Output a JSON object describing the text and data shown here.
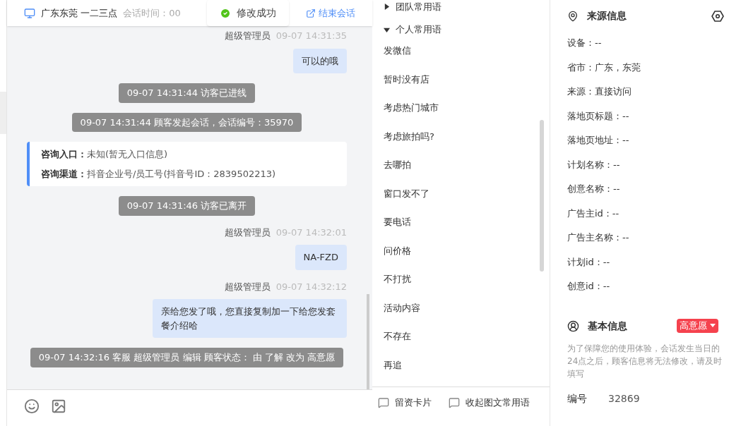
{
  "header": {
    "title": "广东东莞 一二三点",
    "session_time": "会话时间：00",
    "end_link": "结束会话"
  },
  "toast": {
    "text": "修改成功"
  },
  "messages": [
    {
      "kind": "agent",
      "sender": "超级管理员",
      "time": "09-07 14:31:35",
      "text": "可以的哦"
    },
    {
      "kind": "system",
      "text": "09-07 14:31:44 访客已进线"
    },
    {
      "kind": "system",
      "text": "09-07 14:31:44 顾客发起会话，会话编号：35970"
    },
    {
      "kind": "info",
      "rows": [
        {
          "label": "咨询入口：",
          "value": "未知(暂无入口信息)"
        },
        {
          "label": "咨询渠道：",
          "value": "抖音企业号/员工号(抖音号ID：2839502213)"
        }
      ]
    },
    {
      "kind": "system",
      "text": "09-07 14:31:46 访客已离开"
    },
    {
      "kind": "agent",
      "sender": "超级管理员",
      "time": "09-07 14:32:01",
      "text": "NA-FZD"
    },
    {
      "kind": "agent",
      "sender": "超级管理员",
      "time": "09-07 14:32:12",
      "text": "亲给您发了哦，您直接复制加一下给您发套餐介绍哈"
    },
    {
      "kind": "system",
      "text": "09-07 14:32:16 客服 超级管理员 编辑 顾客状态： 由 了解 改为 高意愿"
    }
  ],
  "phrases": {
    "groups": [
      {
        "title": "团队常用语",
        "expanded": false
      },
      {
        "title": "个人常用语",
        "expanded": true
      }
    ],
    "items": [
      "发微信",
      "暂时没有店",
      "考虑热门城市",
      "考虑旅拍吗?",
      "去哪拍",
      "窗口发不了",
      "要电话",
      "问价格",
      "不打扰",
      "活动内容",
      "不存在",
      "再追"
    ],
    "actions": [
      "留资卡片",
      "收起图文常用语"
    ]
  },
  "source_info": {
    "title": "来源信息",
    "fields": [
      "设备：--",
      "省市：广东，东莞",
      "来源：直接访问",
      "落地页标题：--",
      "落地页地址：--",
      "计划名称：--",
      "创意名称：--",
      "广告主id：--",
      "广告主名称：--",
      "计划id：--",
      "创意id：--"
    ]
  },
  "basic_info": {
    "title": "基本信息",
    "status": "高意愿",
    "note": "为了保障您的使用体验，会话发生当日的24点之后，顾客信息将无法修改，请及时填写",
    "id_label": "编号",
    "id_value": "32869"
  }
}
